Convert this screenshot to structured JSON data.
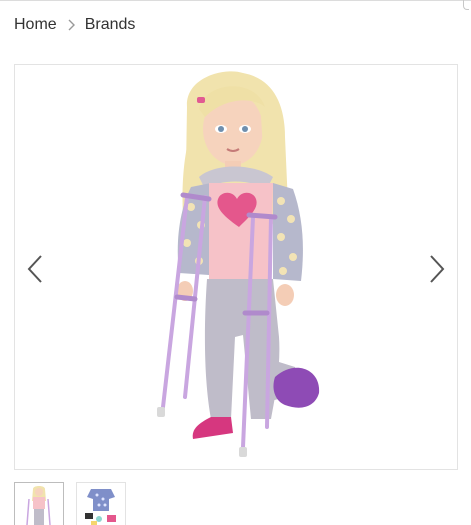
{
  "breadcrumb": {
    "items": [
      {
        "label": "Home"
      },
      {
        "label": "Brands"
      }
    ],
    "separator_icon": "chevron-right-icon"
  },
  "gallery": {
    "prev_icon": "chevron-left-icon",
    "next_icon": "chevron-right-icon",
    "main_image": "doll-with-crutches-image",
    "thumbnails": [
      {
        "icon": "doll-thumbnail-image",
        "selected": true
      },
      {
        "icon": "accessories-thumbnail-image",
        "selected": false
      }
    ]
  },
  "colors": {
    "text": "#333333",
    "border": "#e3e3e3",
    "arrow": "#555555",
    "crutch": "#c9a6e0",
    "pants": "#bfbcc9",
    "top": "#f6c2c8",
    "heart": "#e4578c",
    "hair": "#f1e3ad",
    "cast": "#8e4bb5",
    "sock": "#d6377f"
  }
}
